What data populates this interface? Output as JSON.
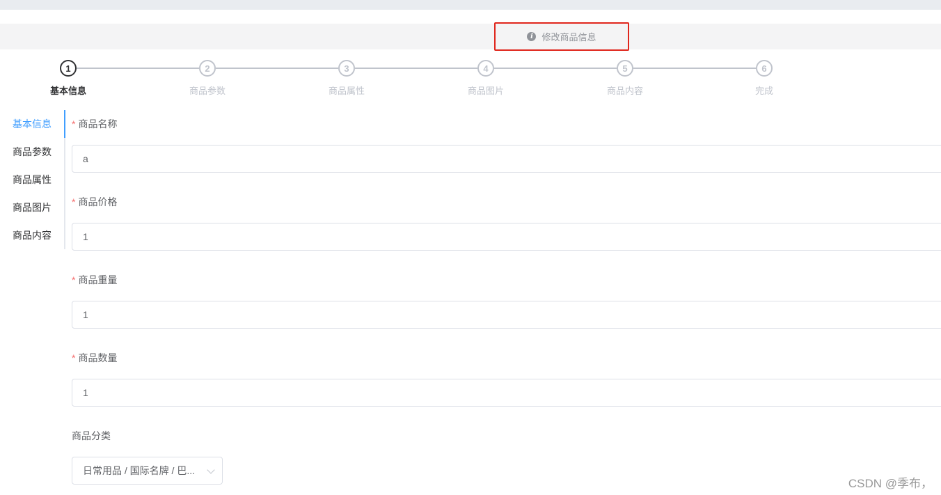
{
  "alert": {
    "icon": "info-icon",
    "text": "修改商品信息"
  },
  "steps": [
    {
      "num": "1",
      "label": "基本信息",
      "active": true
    },
    {
      "num": "2",
      "label": "商品参数",
      "active": false
    },
    {
      "num": "3",
      "label": "商品属性",
      "active": false
    },
    {
      "num": "4",
      "label": "商品图片",
      "active": false
    },
    {
      "num": "5",
      "label": "商品内容",
      "active": false
    },
    {
      "num": "6",
      "label": "完成",
      "active": false
    }
  ],
  "tabs": [
    {
      "label": "基本信息",
      "active": true
    },
    {
      "label": "商品参数",
      "active": false
    },
    {
      "label": "商品属性",
      "active": false
    },
    {
      "label": "商品图片",
      "active": false
    },
    {
      "label": "商品内容",
      "active": false
    }
  ],
  "form": {
    "required_mark": "*",
    "fields": [
      {
        "label": "商品名称",
        "value": "a"
      },
      {
        "label": "商品价格",
        "value": "1"
      },
      {
        "label": "商品重量",
        "value": "1"
      },
      {
        "label": "商品数量",
        "value": "1"
      }
    ],
    "category": {
      "label": "商品分类",
      "value": "日常用品 / 国际名牌 / 巴..."
    }
  },
  "watermark": "CSDN @季布，",
  "colors": {
    "active": "#409eff",
    "required": "#f56c6c",
    "highlight_border": "#e0261c"
  }
}
